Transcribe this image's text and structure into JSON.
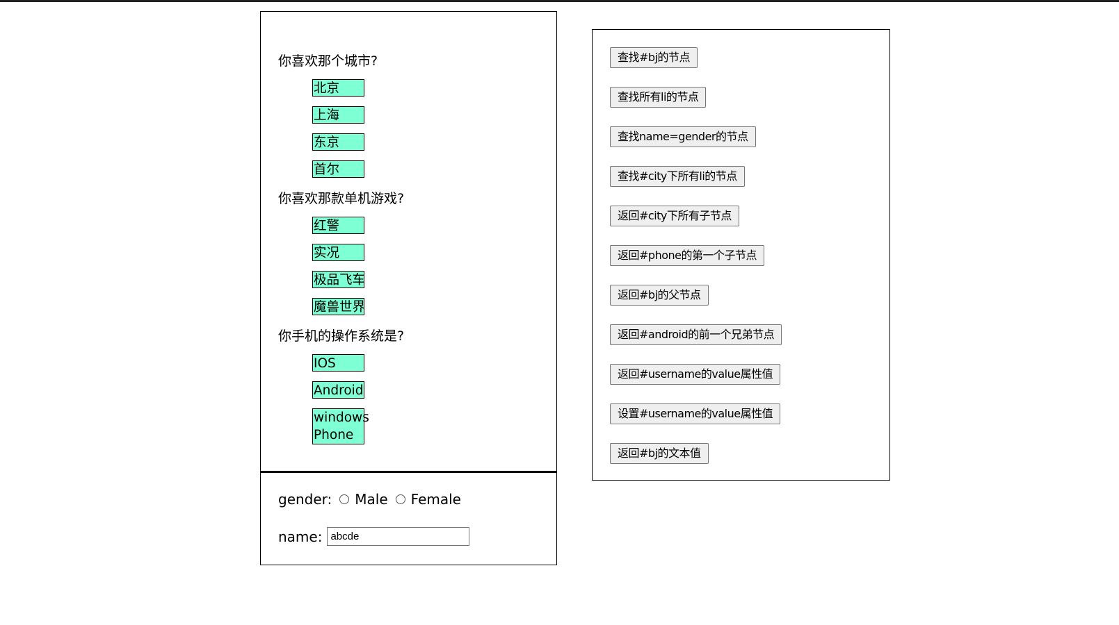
{
  "questions": [
    {
      "label": "你喜欢那个城市?",
      "options": [
        "北京",
        "上海",
        "东京",
        "首尔"
      ]
    },
    {
      "label": "你喜欢那款单机游戏?",
      "options": [
        "红警",
        "实况",
        "极品飞车",
        "魔兽世界"
      ]
    },
    {
      "label": "你手机的操作系统是?",
      "options": [
        "IOS",
        "Android",
        "windows Phone"
      ]
    }
  ],
  "form": {
    "gender_label": "gender:",
    "male_label": "Male",
    "female_label": "Female",
    "name_label": "name:",
    "name_value": "abcde"
  },
  "buttons": [
    "查找#bj的节点",
    "查找所有li的节点",
    "查找name=gender的节点",
    "查找#city下所有li的节点",
    "返回#city下所有子节点",
    "返回#phone的第一个子节点",
    "返回#bj的父节点",
    "返回#android的前一个兄弟节点",
    "返回#username的value属性值",
    "设置#username的value属性值",
    "返回#bj的文本值"
  ],
  "colors": {
    "option_bg": "#7fffd4"
  }
}
